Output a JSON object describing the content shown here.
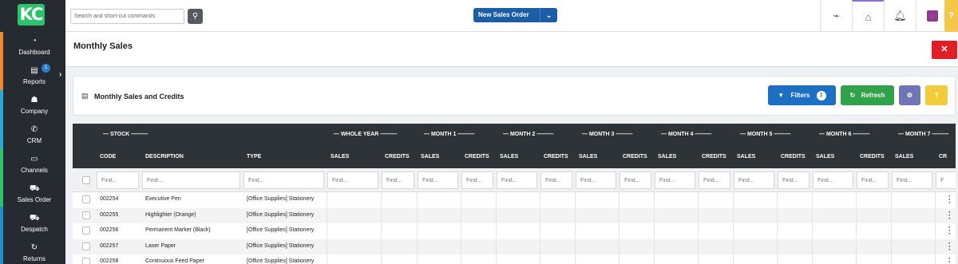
{
  "brand": {
    "logo_text": "KC",
    "accent": "#2cc46b"
  },
  "sidebar": {
    "items": [
      {
        "label": "Dashboard",
        "icon": "speedometer-icon",
        "glyph": "◔"
      },
      {
        "label": "Reports",
        "icon": "document-icon",
        "glyph": "▤",
        "badge": "1"
      },
      {
        "label": "Company",
        "icon": "people-icon",
        "glyph": "☗"
      },
      {
        "label": "CRM",
        "icon": "phone-icon",
        "glyph": "✆"
      },
      {
        "label": "Channels",
        "icon": "inbox-icon",
        "glyph": "▭"
      },
      {
        "label": "Sales Order",
        "icon": "cart-icon",
        "glyph": "⛟"
      },
      {
        "label": "Despatch",
        "icon": "truck-icon",
        "glyph": "⛟"
      },
      {
        "label": "Returns",
        "icon": "return-icon",
        "glyph": "↻"
      }
    ],
    "stripe_colors": [
      "#f0892a",
      "#2aa6d8",
      "#2cc46b",
      "#1d8fc9"
    ]
  },
  "topbar": {
    "search_placeholder": "Search and short-cut commands",
    "new_order_label": "New Sales Order"
  },
  "page": {
    "title": "Monthly Sales"
  },
  "card": {
    "title": "Monthly Sales and Credits",
    "filters_label": "Filters",
    "filters_count": "1",
    "refresh_label": "Refresh"
  },
  "table": {
    "groups": [
      "STOCK",
      "WHOLE YEAR",
      "MONTH 1",
      "MONTH 2",
      "MONTH 3",
      "MONTH 4",
      "MONTH 5",
      "MONTH 6",
      "MONTH 7"
    ],
    "columns": [
      "CODE",
      "DESCRIPTION",
      "TYPE",
      "SALES",
      "CREDITS",
      "SALES",
      "CREDITS",
      "SALES",
      "CREDITS",
      "SALES",
      "CREDITS",
      "SALES",
      "CREDITS",
      "SALES",
      "CREDITS",
      "SALES",
      "CREDITS",
      "SALES",
      "CR"
    ],
    "filter_placeholder": "Find...",
    "filter_partial": "F",
    "rows": [
      {
        "code": "002254",
        "description": "Executive Pen",
        "type": "[Office Supplies] Stationery"
      },
      {
        "code": "002255",
        "description": "Highlighter (Orange)",
        "type": "[Office Supplies] Stationery"
      },
      {
        "code": "002256",
        "description": "Permanent Marker (Black)",
        "type": "[Office Supplies] Stationery"
      },
      {
        "code": "002257",
        "description": "Laser Paper",
        "type": "[Office Supplies] Stationery"
      },
      {
        "code": "002258",
        "description": "Continuous Feed Paper",
        "type": "[Office Supplies] Stationery"
      }
    ]
  }
}
